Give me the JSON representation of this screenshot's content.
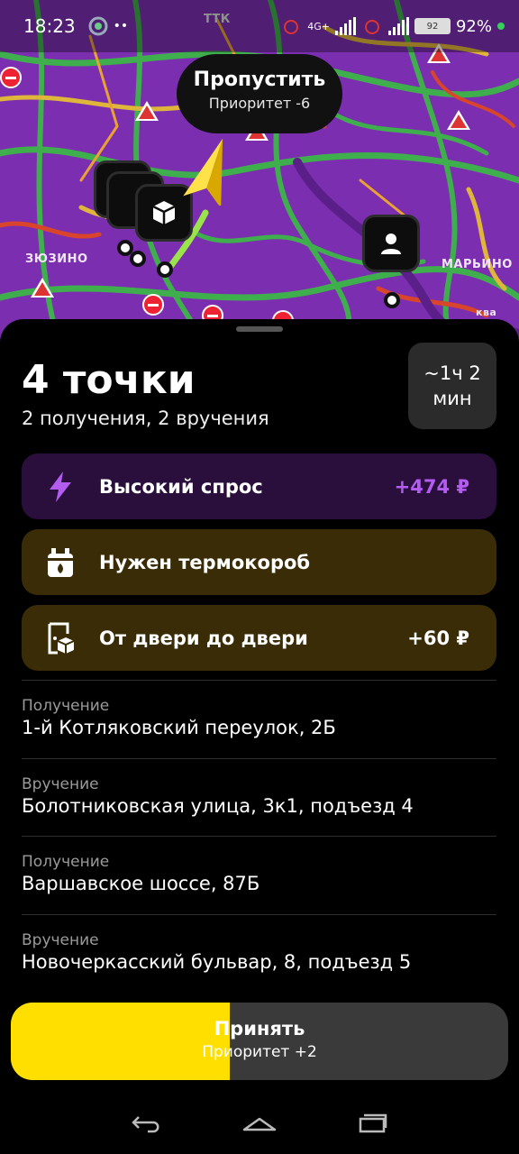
{
  "status_bar": {
    "time": "18:23",
    "network": "4G+",
    "battery_icon_text": "92",
    "battery_percent": "92%"
  },
  "map": {
    "skip_tooltip": {
      "title": "Пропустить",
      "subtitle": "Приоритет -6"
    },
    "districts": {
      "zyuzino": "ЗЮЗИНО",
      "marino": "МАРЬИНО",
      "ttk": "ТТК",
      "river": "ква"
    },
    "colors": {
      "map_bg": "#7b2fb0",
      "traffic_green": "#3fae4c",
      "traffic_yellow": "#e0b63a",
      "traffic_red": "#d8452c"
    }
  },
  "order": {
    "title": "4 точки",
    "subtitle": "2 получения, 2 вручения",
    "eta": {
      "line1": "~1ч 2",
      "line2": "мин"
    },
    "badges": [
      {
        "icon": "lightning-icon",
        "label": "Высокий спрос",
        "value": "+474 ₽",
        "color": "#b25cf0"
      },
      {
        "icon": "thermo-box-icon",
        "label": "Нужен термокороб",
        "value": ""
      },
      {
        "icon": "door-package-icon",
        "label": "От двери до двери",
        "value": "+60 ₽"
      }
    ],
    "stops": [
      {
        "kind": "Получение",
        "address": "1-й Котляковский переулок, 2Б"
      },
      {
        "kind": "Вручение",
        "address": "Болотниковская улица, 3к1, подъезд 4"
      },
      {
        "kind": "Получение",
        "address": "Варшавское шоссе, 87Б"
      },
      {
        "kind": "Вручение",
        "address": "Новочеркасский бульвар, 8, подъезд 5"
      }
    ],
    "accept": {
      "label": "Принять",
      "subtitle": "Приоритет +2",
      "progress_fraction": 0.44,
      "accent": "#ffdf00"
    }
  },
  "nav_bar": {
    "back": "back-icon",
    "home": "home-icon",
    "recents": "recents-icon"
  }
}
